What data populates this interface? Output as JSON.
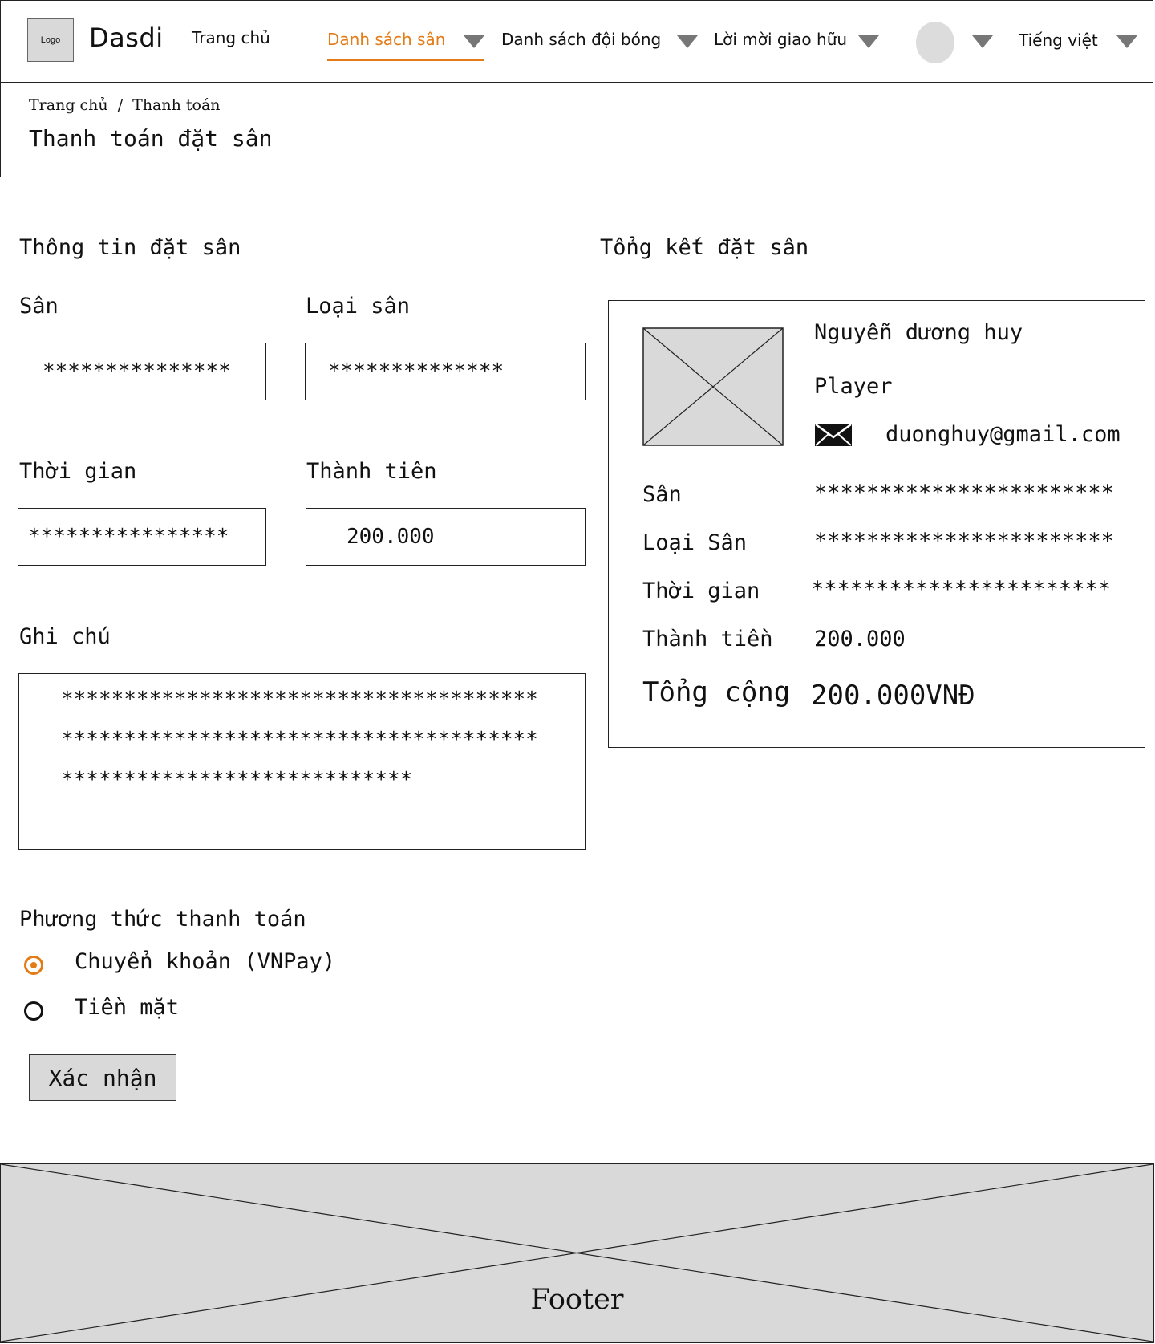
{
  "header": {
    "logo": "Logo",
    "brand": "Dasdi",
    "nav": {
      "home": "Trang chủ",
      "fields": "Danh sách sân",
      "teams": "Danh sách đội bóng",
      "invites": "Lời mời giao hữu",
      "language": "Tiếng việt"
    },
    "colors": {
      "active": "#e37b17",
      "caret": "#777777"
    }
  },
  "breadcrumb": {
    "home": "Trang chủ",
    "separator": "/",
    "current": "Thanh toán"
  },
  "page_title": "Thanh toán đặt sân",
  "booking_info": {
    "title": "Thông tin đặt sân",
    "field_label": "Sân",
    "field_value": "***************",
    "type_label": "Loại sân",
    "type_value": "**************",
    "time_label": "Thời gian",
    "time_value": "****************",
    "amount_label": "Thành tiên",
    "amount_value": "200.000",
    "note_label": "Ghi chú",
    "note_lines": [
      "**************************************",
      "**************************************",
      "****************************"
    ]
  },
  "summary": {
    "title": "Tổng kết đặt sân",
    "name": "Nguyễn dương huy",
    "role": "Player",
    "email": "duonghuy@gmail.com",
    "rows": [
      {
        "label": "Sân",
        "value": "***********************"
      },
      {
        "label": "Loại Sân",
        "value": "***********************"
      },
      {
        "label": "Thời gian",
        "value": "***********************"
      },
      {
        "label": "Thành tiền",
        "value": "200.000"
      }
    ],
    "total_label": "Tổng cộng",
    "total_value": "200.000VNĐ"
  },
  "payment": {
    "title": "Phương thức thanh toán",
    "options": [
      {
        "label": "Chuyển khoản (VNPay)",
        "checked": true
      },
      {
        "label": "Tiền mặt",
        "checked": false
      }
    ],
    "confirm": "Xác nhận"
  },
  "footer": {
    "label": "Footer"
  }
}
